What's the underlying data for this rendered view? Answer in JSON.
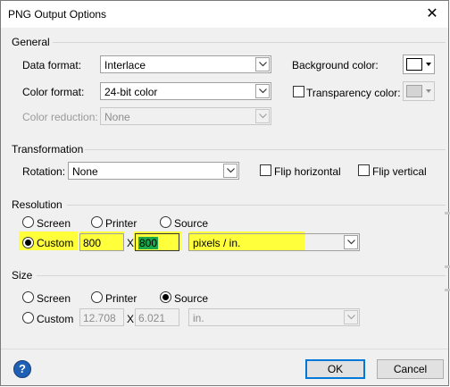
{
  "window": {
    "title": "PNG Output Options",
    "close_glyph": "✕"
  },
  "general": {
    "title": "General",
    "data_format": {
      "label": "Data format:",
      "value": "Interlace"
    },
    "color_format": {
      "label": "Color format:",
      "value": "24-bit color"
    },
    "color_reduction": {
      "label": "Color reduction:",
      "value": "None"
    },
    "background_color": {
      "label": "Background color:",
      "color": "#ffffff"
    },
    "transparency_color": {
      "label": "Transparency color:",
      "checked": false,
      "color": "#d4d4d4"
    }
  },
  "transformation": {
    "title": "Transformation",
    "rotation": {
      "label": "Rotation:",
      "value": "None"
    },
    "flip_horizontal": {
      "label": "Flip horizontal",
      "checked": false
    },
    "flip_vertical": {
      "label": "Flip vertical",
      "checked": false
    }
  },
  "resolution": {
    "title": "Resolution",
    "options": {
      "screen": "Screen",
      "printer": "Printer",
      "source": "Source",
      "custom": "Custom"
    },
    "selected": "custom",
    "width": "800",
    "x_label": "X",
    "height": "800",
    "units": "pixels / in.",
    "highlight_color": "#ffff3c"
  },
  "size": {
    "title": "Size",
    "options": {
      "screen": "Screen",
      "printer": "Printer",
      "source": "Source",
      "custom": "Custom"
    },
    "selected": "source",
    "width": "12.708",
    "x_label": "X",
    "height": "6.021",
    "units": "in."
  },
  "footer": {
    "help_glyph": "?",
    "ok_label": "OK",
    "cancel_label": "Cancel"
  },
  "colors": {
    "accent": "#0078d7",
    "dialog_bg": "#f0f0f0"
  }
}
